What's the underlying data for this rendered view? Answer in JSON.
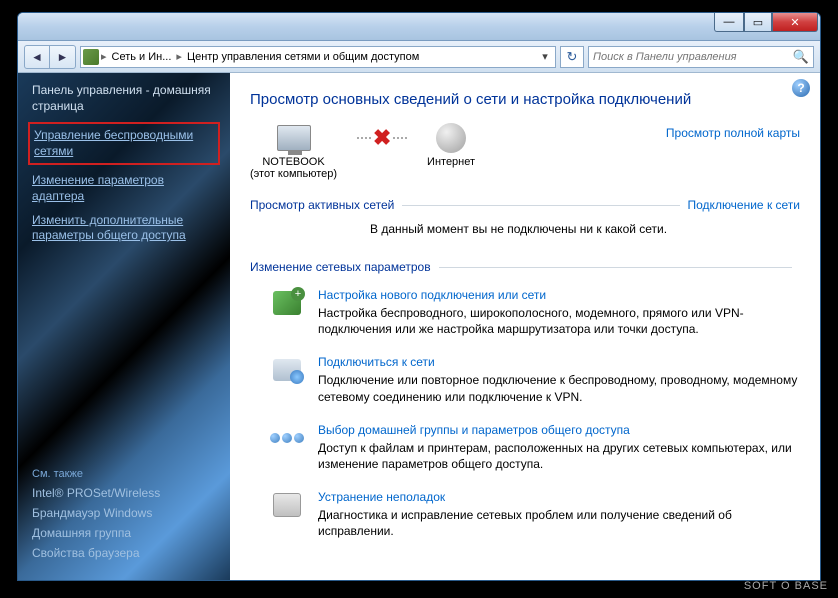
{
  "titlebar": {
    "min": "—",
    "max": "▭",
    "close": "✕"
  },
  "nav": {
    "back": "◄",
    "forward": "►"
  },
  "breadcrumb": {
    "seg1": "Сеть и Ин...",
    "seg2": "Центр управления сетями и общим доступом",
    "sep": "▸",
    "dd": "▾",
    "refresh": "↻"
  },
  "search": {
    "placeholder": "Поиск в Панели управления",
    "icon": "🔍"
  },
  "sidebar": {
    "home": "Панель управления - домашняя страница",
    "links": [
      "Управление беспроводными сетями",
      "Изменение параметров адаптера",
      "Изменить дополнительные параметры общего доступа"
    ],
    "see_also_title": "См. также",
    "see_also": [
      "Intel® PROSet/Wireless",
      "Брандмауэр Windows",
      "Домашняя группа",
      "Свойства браузера"
    ]
  },
  "main": {
    "help": "?",
    "heading": "Просмотр основных сведений о сети и настройка подключений",
    "maplink": "Просмотр полной карты",
    "node1_name": "NOTEBOOK",
    "node1_sub": "(этот компьютер)",
    "node2_name": "Интернет",
    "conn_x": "✖",
    "active_title": "Просмотр активных сетей",
    "active_link": "Подключение к сети",
    "nocon": "В данный момент вы не подключены ни к какой сети.",
    "change_title": "Изменение сетевых параметров",
    "tasks": [
      {
        "title": "Настройка нового подключения или сети",
        "desc": "Настройка беспроводного, широкополосного, модемного, прямого или VPN-подключения или же настройка маршрутизатора или точки доступа."
      },
      {
        "title": "Подключиться к сети",
        "desc": "Подключение или повторное подключение к беспроводному, проводному, модемному сетевому соединению или подключение к VPN."
      },
      {
        "title": "Выбор домашней группы и параметров общего доступа",
        "desc": "Доступ к файлам и принтерам, расположенных на других сетевых компьютерах, или изменение параметров общего доступа."
      },
      {
        "title": "Устранение неполадок",
        "desc": "Диагностика и исправление сетевых проблем или получение сведений об исправлении."
      }
    ]
  },
  "watermark": "SOFT O BASE"
}
